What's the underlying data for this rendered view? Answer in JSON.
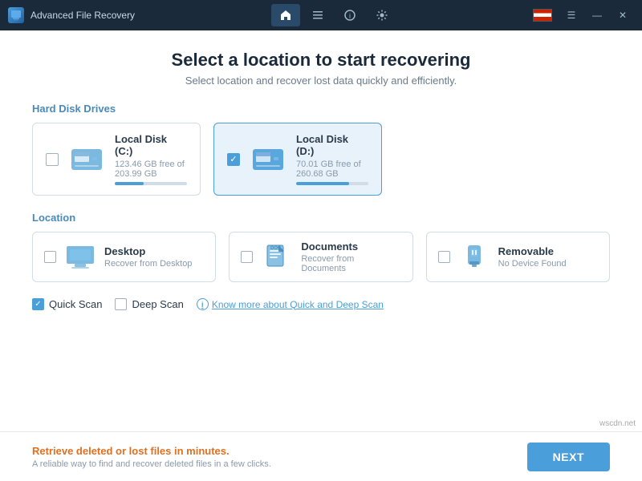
{
  "titlebar": {
    "app_icon_label": "A",
    "app_title": "Advanced File Recovery",
    "nav_home_label": "🏠",
    "nav_list_label": "≡",
    "nav_info_label": "ℹ",
    "nav_settings_label": "⚙",
    "win_flag_label": "",
    "win_menu_label": "☰",
    "win_min_label": "—",
    "win_close_label": "✕"
  },
  "header": {
    "title": "Select a location to start recovering",
    "subtitle": "Select location and recover lost data quickly and efficiently."
  },
  "hard_disk_section": {
    "label": "Hard Disk Drives",
    "drives": [
      {
        "name": "Local Disk (C:)",
        "size": "123.46 GB free of 203.99 GB",
        "selected": false,
        "fill_pct": 40
      },
      {
        "name": "Local Disk (D:)",
        "size": "70.01 GB free of 260.68 GB",
        "selected": true,
        "fill_pct": 73
      }
    ]
  },
  "location_section": {
    "label": "Location",
    "items": [
      {
        "name": "Desktop",
        "sub": "Recover from Desktop",
        "selected": false
      },
      {
        "name": "Documents",
        "sub": "Recover from Documents",
        "selected": false
      },
      {
        "name": "Removable",
        "sub": "No Device Found",
        "selected": false
      }
    ]
  },
  "scan_options": {
    "quick_scan_label": "Quick Scan",
    "quick_scan_checked": true,
    "deep_scan_label": "Deep Scan",
    "deep_scan_checked": false,
    "info_link_label": "Know more about Quick and Deep Scan"
  },
  "footer": {
    "main_text": "Retrieve deleted or lost files in minutes.",
    "sub_text": "A reliable way to find and recover deleted files in a few clicks.",
    "next_label": "NEXT"
  },
  "watermark": "wscdn.net"
}
